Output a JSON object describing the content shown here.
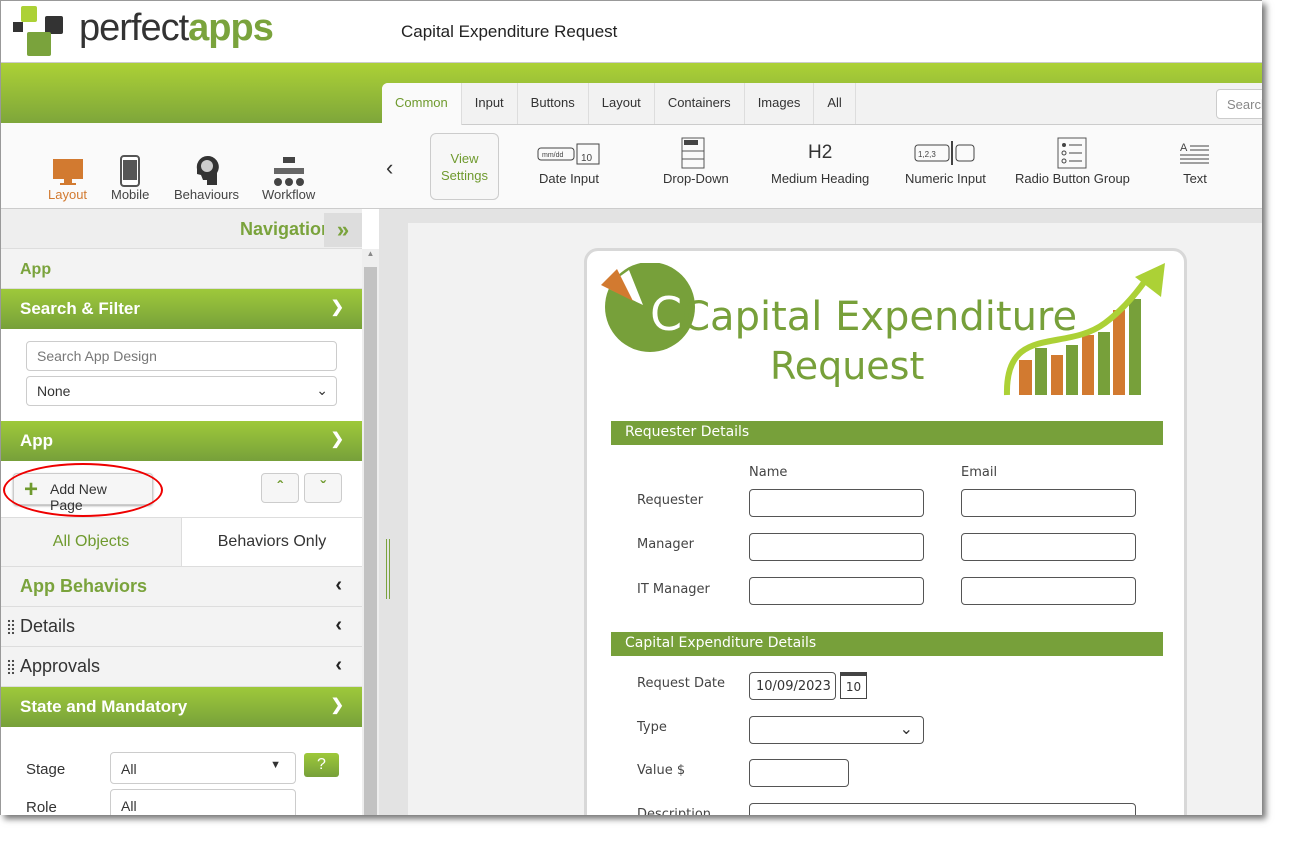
{
  "header": {
    "logo_text_1": "perfect",
    "logo_text_2": "apps",
    "title": "Capital Expenditure Request"
  },
  "modes": [
    {
      "label": "Layout",
      "icon": "monitor-icon",
      "active": true
    },
    {
      "label": "Mobile",
      "icon": "mobile-icon"
    },
    {
      "label": "Behaviours",
      "icon": "brain-icon"
    },
    {
      "label": "Workflow",
      "icon": "workflow-icon"
    }
  ],
  "toolbox": {
    "tabs": [
      "Common",
      "Input",
      "Buttons",
      "Layout",
      "Containers",
      "Images",
      "All"
    ],
    "active_tab": "Common",
    "search_placeholder": "Search",
    "view_settings": "View Settings",
    "tools": [
      {
        "label": "Date Input",
        "icon": "date-input-icon"
      },
      {
        "label": "Drop-Down",
        "icon": "dropdown-icon"
      },
      {
        "label": "Medium Heading",
        "icon": "h2-icon",
        "glyph": "H2"
      },
      {
        "label": "Numeric Input",
        "icon": "numeric-input-icon"
      },
      {
        "label": "Radio Button Group",
        "icon": "radio-group-icon"
      },
      {
        "label": "Text",
        "icon": "text-icon"
      }
    ]
  },
  "nav": {
    "title": "Navigation",
    "app_label": "App",
    "search_filter": "Search & Filter",
    "search_placeholder": "Search App Design",
    "filter_value": "None",
    "app_section": "App",
    "add_page": "Add New Page",
    "tabs": [
      "All Objects",
      "Behaviors Only"
    ],
    "items": [
      "App Behaviors",
      "Details",
      "Approvals"
    ],
    "state_section": "State and Mandatory",
    "stage_label": "Stage",
    "stage_value": "All",
    "help": "?",
    "second_label": "Role",
    "second_value": "All"
  },
  "form": {
    "title_line1": "Capital Expenditure",
    "title_line2": "Request",
    "requester_section": "Requester Details",
    "col_name": "Name",
    "col_email": "Email",
    "rows": [
      "Requester",
      "Manager",
      "IT Manager"
    ],
    "capex_section": "Capital Expenditure Details",
    "request_date_label": "Request Date",
    "request_date_value": "10/09/2023",
    "calendar_day": "10",
    "type_label": "Type",
    "value_label": "Value $",
    "description_label": "Description"
  },
  "colors": {
    "brand_green": "#7aa33c",
    "band_green": "#acd136",
    "accent_orange": "#d27a30"
  }
}
